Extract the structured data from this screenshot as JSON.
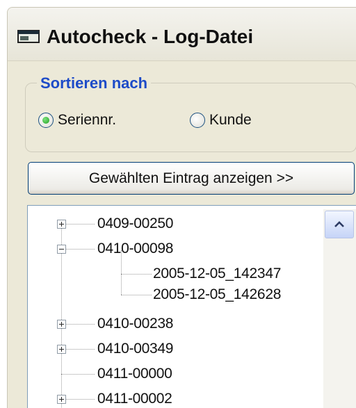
{
  "window": {
    "title": "Autocheck - Log-Datei"
  },
  "sort_group": {
    "legend": "Sortieren nach",
    "options": [
      {
        "label": "Seriennr.",
        "selected": true
      },
      {
        "label": "Kunde",
        "selected": false
      }
    ]
  },
  "show_button": {
    "label": "Gewählten Eintrag anzeigen >>"
  },
  "tree": {
    "items": [
      {
        "label": "0409-00250",
        "level": 0,
        "expander": "plus"
      },
      {
        "label": "0410-00098",
        "level": 0,
        "expander": "minus"
      },
      {
        "label": "2005-12-05_142347",
        "level": 1,
        "expander": "none"
      },
      {
        "label": "2005-12-05_142628",
        "level": 1,
        "expander": "none"
      },
      {
        "label": "0410-00238",
        "level": 0,
        "expander": "plus"
      },
      {
        "label": "0410-00349",
        "level": 0,
        "expander": "plus"
      },
      {
        "label": "0411-00000",
        "level": 0,
        "expander": "none"
      },
      {
        "label": "0411-00002",
        "level": 0,
        "expander": "plus"
      }
    ]
  },
  "icons": {
    "app": "window-icon",
    "scroll_up": "chevron-up-icon"
  },
  "colors": {
    "legend": "#1d4bc8",
    "radio_selected": "#21a121",
    "button_border": "#003c74"
  }
}
